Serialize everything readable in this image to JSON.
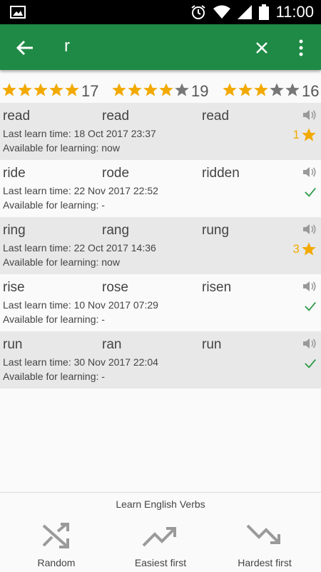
{
  "status_bar": {
    "time": "11:00"
  },
  "toolbar": {
    "query": "r"
  },
  "star_groups": [
    {
      "stars_filled": 5,
      "stars_total": 5,
      "count": "17"
    },
    {
      "stars_filled": 4,
      "stars_total": 5,
      "count": "19"
    },
    {
      "stars_filled": 3,
      "stars_total": 5,
      "count": "16"
    }
  ],
  "verbs": [
    {
      "base": "read",
      "past": "read",
      "participle": "read",
      "last_learn": "Last learn time: 18 Oct 2017 23:37",
      "available": "Available for learning: now",
      "status": "star",
      "status_value": "1"
    },
    {
      "base": "ride",
      "past": "rode",
      "participle": "ridden",
      "last_learn": "Last learn time: 22 Nov 2017 22:52",
      "available": "Available for learning: -",
      "status": "check",
      "status_value": ""
    },
    {
      "base": "ring",
      "past": "rang",
      "participle": "rung",
      "last_learn": "Last learn time: 22 Oct 2017 14:36",
      "available": "Available for learning: now",
      "status": "star",
      "status_value": "3"
    },
    {
      "base": "rise",
      "past": "rose",
      "participle": "risen",
      "last_learn": "Last learn time: 10 Nov 2017 07:29",
      "available": "Available for learning: -",
      "status": "check",
      "status_value": ""
    },
    {
      "base": "run",
      "past": "ran",
      "participle": "run",
      "last_learn": "Last learn time: 30 Nov 2017 22:04",
      "available": "Available for learning: -",
      "status": "check",
      "status_value": ""
    }
  ],
  "bottom": {
    "title": "Learn English Verbs",
    "random_label": "Random",
    "easiest_label": "Easiest first",
    "hardest_label": "Hardest first"
  },
  "colors": {
    "toolbar": "#1e8a45",
    "star": "#f2a900",
    "star_empty": "#777777",
    "check": "#2e9a48"
  }
}
